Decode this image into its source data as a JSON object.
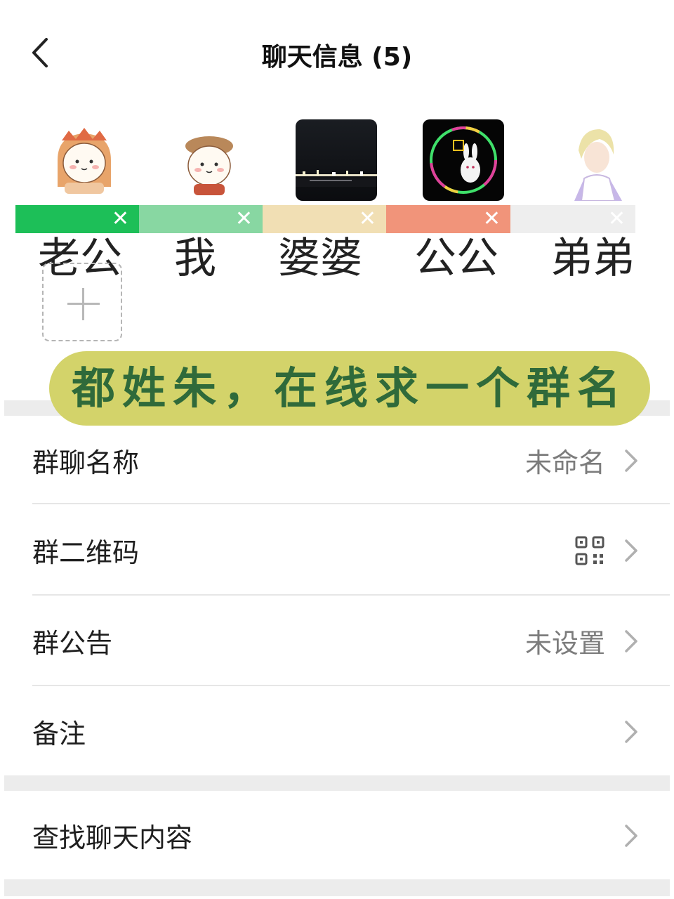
{
  "header": {
    "title": "聊天信息 (5)"
  },
  "members": [
    {
      "name": "老公",
      "bar_color": "#1dbf58",
      "avatar": "cartoon-crown-bun"
    },
    {
      "name": "我",
      "bar_color": "#88d7a2",
      "avatar": "cartoon-hat-bun"
    },
    {
      "name": "婆婆",
      "bar_color": "#f1dfb4",
      "avatar": "night-city-lights"
    },
    {
      "name": "公公",
      "bar_color": "#f1947a",
      "avatar": "neon-rabbit-zhu"
    },
    {
      "name": "弟弟",
      "bar_color": "#eeeeee",
      "avatar": "anime-blond-man"
    }
  ],
  "remove_mark": "✕",
  "banner": {
    "text": "都姓朱，在线求一个群名",
    "color": "#d3d36a",
    "text_color": "#2f6a3a"
  },
  "settings": [
    {
      "label": "群聊名称",
      "value": "未命名"
    },
    {
      "label": "群二维码",
      "value": "",
      "icon": "qr-code-icon"
    },
    {
      "label": "群公告",
      "value": "未设置"
    },
    {
      "label": "备注",
      "value": ""
    }
  ],
  "search": {
    "label": "查找聊天内容"
  }
}
